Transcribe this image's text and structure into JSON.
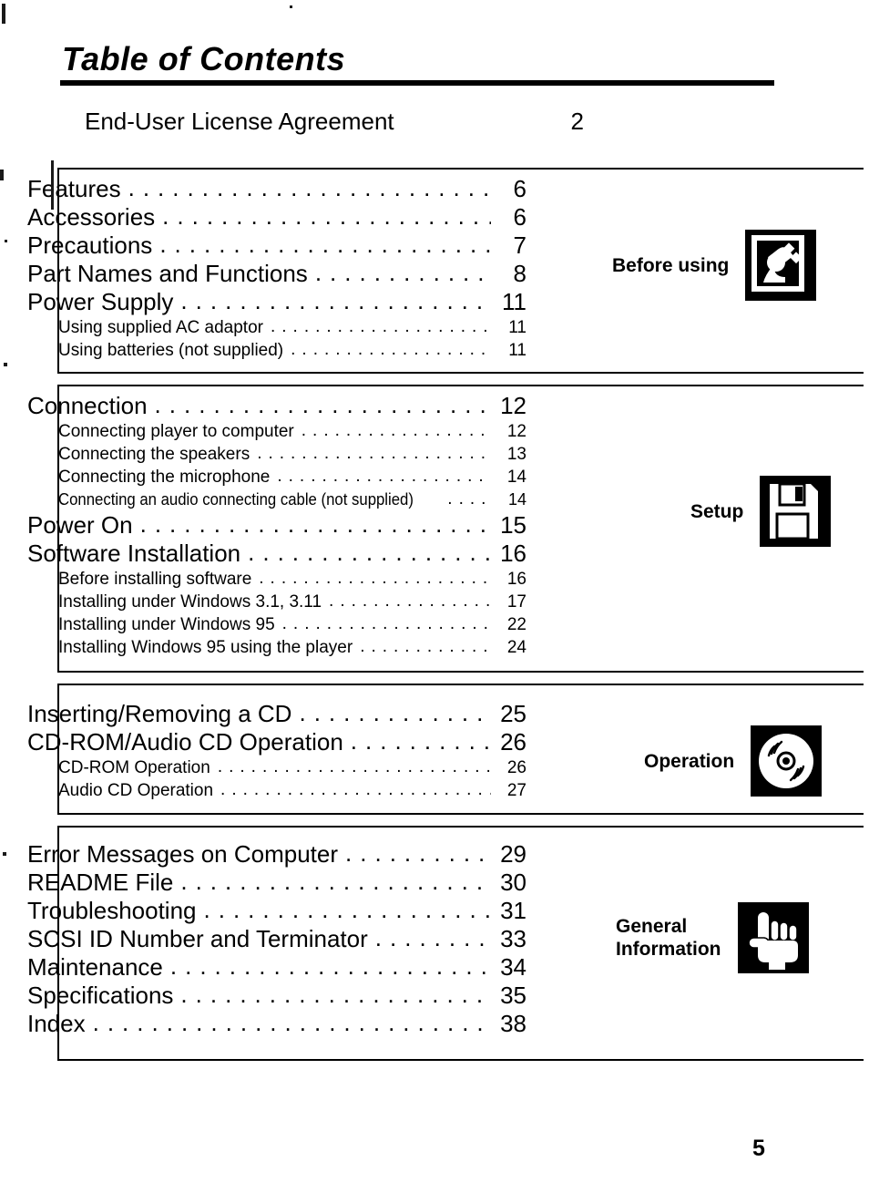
{
  "page": {
    "title": "Table of Contents",
    "folio": "5"
  },
  "standalone_entry": {
    "label": "End-User License Agreement",
    "page": "2"
  },
  "sections": [
    {
      "category": "Before using",
      "icon": "power-plug-icon",
      "entries": [
        {
          "level": 1,
          "label": "Features",
          "page": "6"
        },
        {
          "level": 1,
          "label": "Accessories",
          "page": "6"
        },
        {
          "level": 1,
          "label": "Precautions",
          "page": "7"
        },
        {
          "level": 1,
          "label": "Part Names and Functions",
          "page": "8"
        },
        {
          "level": 1,
          "label": "Power Supply",
          "page": "11"
        },
        {
          "level": 2,
          "label": "Using supplied AC adaptor",
          "page": "11"
        },
        {
          "level": 2,
          "label": "Using batteries (not supplied)",
          "page": "11"
        }
      ]
    },
    {
      "category": "Setup",
      "icon": "floppy-disk-icon",
      "entries": [
        {
          "level": 1,
          "label": "Connection",
          "page": "12"
        },
        {
          "level": 2,
          "label": "Connecting player to computer",
          "page": "12"
        },
        {
          "level": 2,
          "label": "Connecting the speakers",
          "page": "13"
        },
        {
          "level": 2,
          "label": "Connecting the microphone",
          "page": "14"
        },
        {
          "level": 2,
          "condensed": true,
          "label": "Connecting an audio connecting cable (not supplied)",
          "page": "14"
        },
        {
          "level": 1,
          "label": "Power On",
          "page": "15"
        },
        {
          "level": 1,
          "label": "Software Installation",
          "page": "16"
        },
        {
          "level": 2,
          "label": "Before installing software",
          "page": "16"
        },
        {
          "level": 2,
          "label": "Installing under Windows 3.1, 3.11",
          "page": "17"
        },
        {
          "level": 2,
          "label": "Installing under Windows 95",
          "page": "22"
        },
        {
          "level": 2,
          "label": "Installing Windows 95 using the player",
          "page": "24"
        }
      ]
    },
    {
      "category": "Operation",
      "icon": "compact-disc-icon",
      "entries": [
        {
          "level": 1,
          "label": "Inserting/Removing a CD",
          "page": "25"
        },
        {
          "level": 1,
          "label": "CD-ROM/Audio CD Operation",
          "page": "26"
        },
        {
          "level": 2,
          "label": "CD-ROM Operation",
          "page": "26"
        },
        {
          "level": 2,
          "label": "Audio CD Operation",
          "page": "27"
        }
      ]
    },
    {
      "category": "General\nInformation",
      "icon": "pointing-hand-icon",
      "entries": [
        {
          "level": 1,
          "label": "Error Messages on Computer",
          "page": "29"
        },
        {
          "level": 1,
          "label": "README File",
          "page": "30"
        },
        {
          "level": 1,
          "label": "Troubleshooting",
          "page": "31"
        },
        {
          "level": 1,
          "label": "SCSI ID Number and Terminator",
          "page": "33"
        },
        {
          "level": 1,
          "label": "Maintenance",
          "page": "34"
        },
        {
          "level": 1,
          "label": "Specifications",
          "page": "35"
        },
        {
          "level": 1,
          "label": "Index",
          "page": "38"
        }
      ]
    }
  ],
  "colors": {
    "ink": "#000000",
    "paper": "#ffffff"
  }
}
